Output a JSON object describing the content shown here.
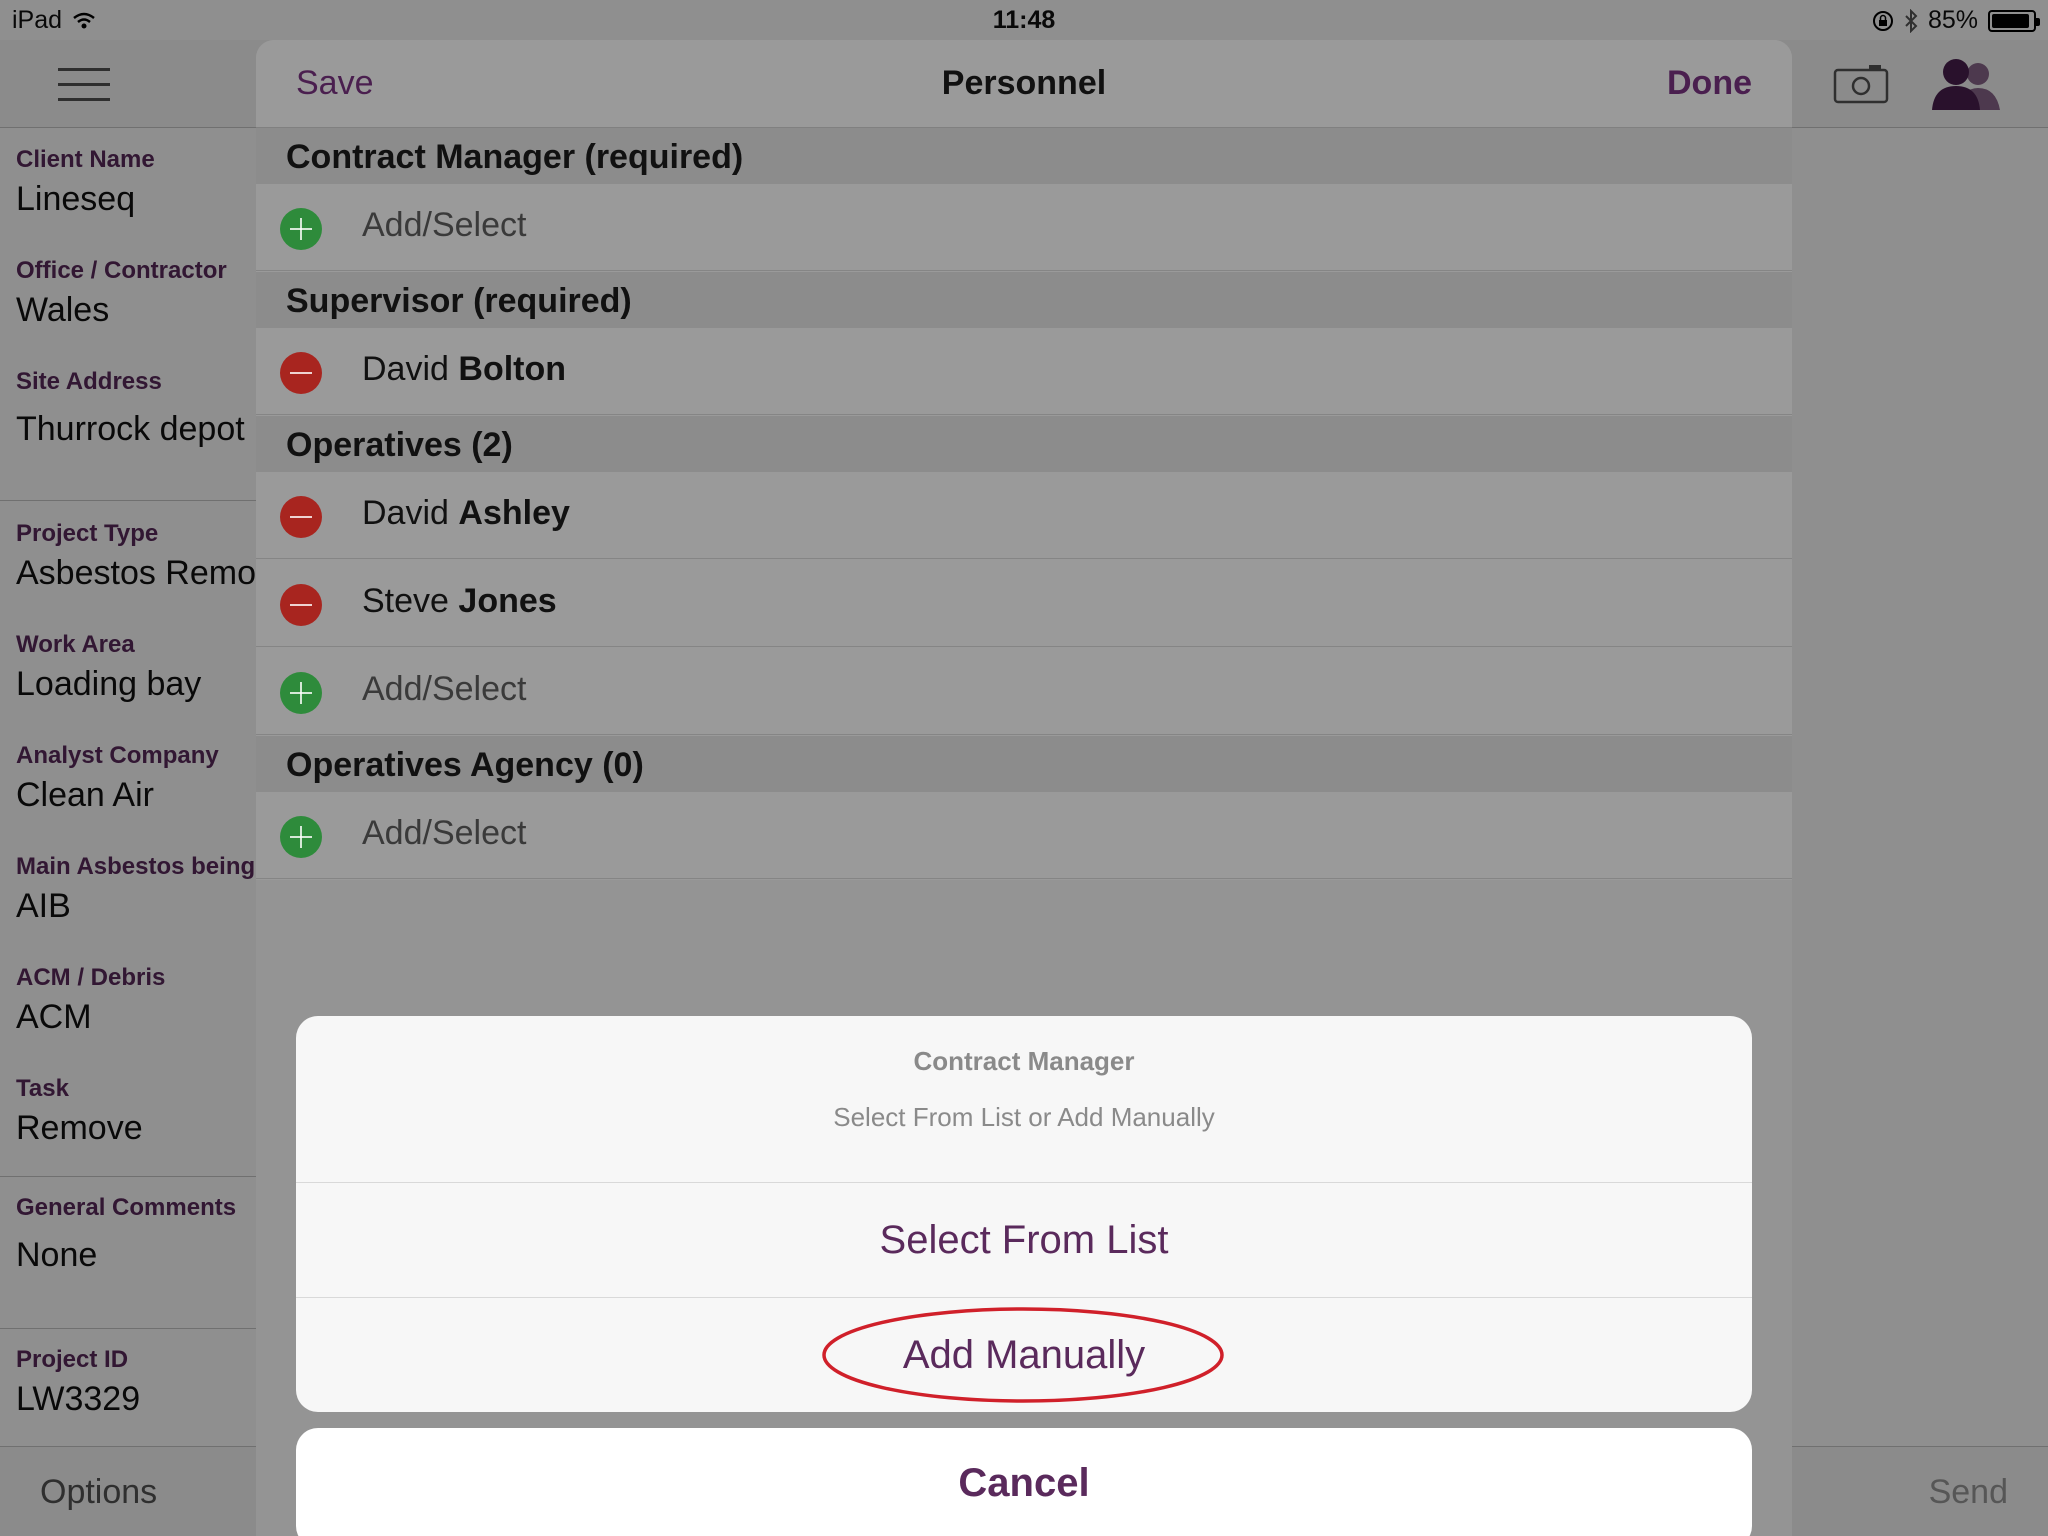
{
  "status_bar": {
    "device": "iPad",
    "time": "11:48",
    "battery": "85%",
    "battery_level": 0.85
  },
  "background": {
    "fields": [
      {
        "label": "Client Name",
        "value": "Lineseq"
      },
      {
        "label": "Office / Contractor",
        "value": "Wales"
      },
      {
        "label": "Site Address",
        "value": "Thurrock depot"
      },
      {
        "label": "Project Type",
        "value": "Asbestos Removal"
      },
      {
        "label": "Work Area",
        "value": "Loading bay"
      },
      {
        "label": "Analyst Company",
        "value": "Clean Air"
      },
      {
        "label": "Main Asbestos being",
        "value": "AIB"
      },
      {
        "label": "ACM / Debris",
        "value": "ACM"
      },
      {
        "label": "Task",
        "value": "Remove"
      },
      {
        "label": "General Comments",
        "value": "None"
      },
      {
        "label": "Project ID",
        "value": "LW3329"
      }
    ],
    "bottom_bar": {
      "options": "Options",
      "send": "Send"
    }
  },
  "modal": {
    "save": "Save",
    "title": "Personnel",
    "done": "Done",
    "sections": {
      "contract_manager": {
        "header": "Contract Manager (required)",
        "add": "Add/Select"
      },
      "supervisor": {
        "header": "Supervisor (required)",
        "people": [
          {
            "first": "David",
            "last": "Bolton"
          }
        ]
      },
      "operatives": {
        "header": "Operatives (2)",
        "people": [
          {
            "first": "David",
            "last": "Ashley"
          },
          {
            "first": "Steve",
            "last": "Jones"
          }
        ],
        "add": "Add/Select"
      },
      "agency": {
        "header": "Operatives Agency (0)",
        "add": "Add/Select"
      }
    }
  },
  "action_sheet": {
    "title": "Contract Manager",
    "message": "Select From List or Add Manually",
    "select_from_list": "Select From List",
    "add_manually": "Add Manually",
    "cancel": "Cancel"
  },
  "colors": {
    "accent": "#5a2a5c",
    "add_green": "#2e8b3b",
    "remove_red": "#a8251f",
    "highlight_red": "#d0202a"
  }
}
